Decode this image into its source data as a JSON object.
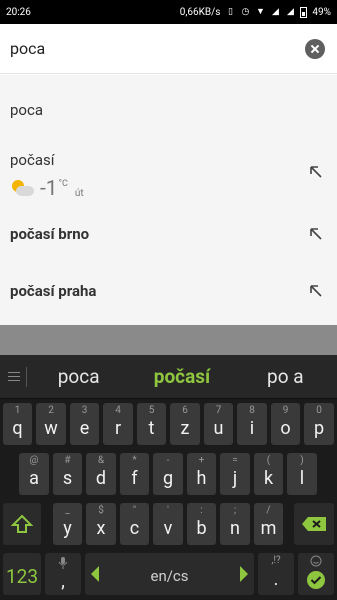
{
  "status_bar": {
    "time": "20:26",
    "network_speed": "0,66KB/s",
    "icons": [
      "vibrate-icon",
      "alarm-icon",
      "wifi-icon",
      "signal-icon",
      "signal2-icon"
    ],
    "battery": "49%"
  },
  "search": {
    "query": "poca",
    "clear_icon": "clear-icon"
  },
  "suggestions": {
    "items": [
      {
        "text": "poca",
        "bold": false
      },
      {
        "text": "počasí",
        "bold": false
      },
      {
        "text": "počasí brno",
        "bold": true
      },
      {
        "text": "počasí praha",
        "bold": true
      }
    ],
    "weather": {
      "temp": "-1",
      "unit": "°C",
      "day": "út",
      "icon": "partly-cloudy-icon"
    }
  },
  "keyboard": {
    "candidates": [
      "poca",
      "počasí",
      "po a"
    ],
    "menu_icon": "menu-icon",
    "row1": [
      {
        "k": "q",
        "h": "1"
      },
      {
        "k": "w",
        "h": "2"
      },
      {
        "k": "e",
        "h": "3"
      },
      {
        "k": "r",
        "h": "4"
      },
      {
        "k": "t",
        "h": "5"
      },
      {
        "k": "z",
        "h": "6"
      },
      {
        "k": "u",
        "h": "7"
      },
      {
        "k": "i",
        "h": "8"
      },
      {
        "k": "o",
        "h": "9"
      },
      {
        "k": "p",
        "h": "0"
      }
    ],
    "row2": [
      {
        "k": "a",
        "h": "@"
      },
      {
        "k": "s",
        "h": "#"
      },
      {
        "k": "d",
        "h": "&"
      },
      {
        "k": "f",
        "h": "*"
      },
      {
        "k": "g",
        "h": "-"
      },
      {
        "k": "h",
        "h": "+"
      },
      {
        "k": "j",
        "h": "="
      },
      {
        "k": "k",
        "h": "("
      },
      {
        "k": "l",
        "h": ")"
      }
    ],
    "row3": [
      {
        "k": "y",
        "h": "_"
      },
      {
        "k": "x",
        "h": "$"
      },
      {
        "k": "c",
        "h": "\""
      },
      {
        "k": "v",
        "h": "'"
      },
      {
        "k": "b",
        "h": ":"
      },
      {
        "k": "n",
        "h": ";"
      },
      {
        "k": "m",
        "h": "/"
      }
    ],
    "shift_icon": "shift-icon",
    "backspace_icon": "backspace-icon",
    "bottom": {
      "numbers_label": "123",
      "mic_icon": "mic-icon",
      "comma_label": ",",
      "lang_label": "en/cs",
      "period_label": ".",
      "period_hint": ",!?",
      "emoji_icon": "emoji-icon",
      "enter_icon": "check-icon",
      "left_arrow_icon": "left-arrow-icon",
      "right_arrow_icon": "right-arrow-icon"
    }
  }
}
